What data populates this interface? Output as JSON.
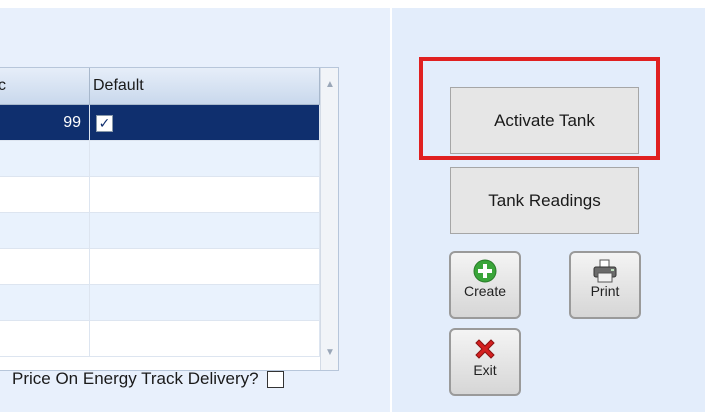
{
  "grid": {
    "columns": [
      "c",
      "Default"
    ],
    "rows": [
      {
        "value": "99",
        "default": true,
        "selected": true
      },
      {
        "value": "",
        "default": false,
        "selected": false
      },
      {
        "value": "",
        "default": false,
        "selected": false
      },
      {
        "value": "",
        "default": false,
        "selected": false
      },
      {
        "value": "",
        "default": false,
        "selected": false
      },
      {
        "value": "",
        "default": false,
        "selected": false
      },
      {
        "value": "",
        "default": false,
        "selected": false
      }
    ]
  },
  "options": {
    "price_on_delivery_label": "Price On Energy Track Delivery?",
    "price_on_delivery_checked": false
  },
  "actions": {
    "activate_tank_label": "Activate Tank",
    "tank_readings_label": "Tank Readings",
    "create_label": "Create",
    "print_label": "Print",
    "exit_label": "Exit"
  },
  "icons": {
    "create": "plus-circle-icon",
    "print": "printer-icon",
    "exit": "red-x-icon"
  },
  "colors": {
    "selected_row": "#0f2f6e",
    "highlight": "#e02020",
    "create_icon": "#3aa53a",
    "exit_icon": "#d42020"
  }
}
